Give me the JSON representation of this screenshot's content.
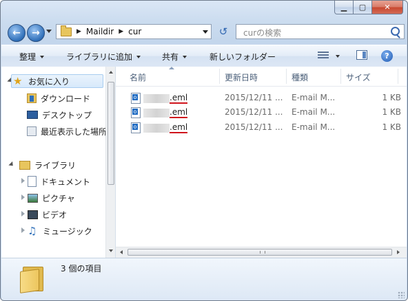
{
  "window": {
    "caption_min": "▁",
    "caption_max": "▢",
    "caption_close": "✕"
  },
  "navigation": {
    "breadcrumb": [
      "Maildir",
      "cur"
    ],
    "search_placeholder": "curの検索"
  },
  "toolbar": {
    "organize": "整理",
    "include_in_library": "ライブラリに追加",
    "share_with": "共有",
    "new_folder": "新しいフォルダー"
  },
  "sidebar": {
    "favorites": "お気に入り",
    "downloads": "ダウンロード",
    "desktop": "デスクトップ",
    "recent_places": "最近表示した場所",
    "libraries": "ライブラリ",
    "documents": "ドキュメント",
    "pictures": "ピクチャ",
    "videos": "ビデオ",
    "music": "ミュージック"
  },
  "columns": {
    "name": "名前",
    "date_modified": "更新日時",
    "type": "種類",
    "size": "サイズ"
  },
  "files": [
    {
      "ext": ".eml",
      "date": "2015/12/11 ...",
      "type": "E-mail M...",
      "size": "1 KB"
    },
    {
      "ext": ".eml",
      "date": "2015/12/11 ...",
      "type": "E-mail M...",
      "size": "1 KB"
    },
    {
      "ext": ".eml",
      "date": "2015/12/11 ...",
      "type": "E-mail M...",
      "size": "1 KB"
    }
  ],
  "status": {
    "item_count": "3 個の項目"
  },
  "colors": {
    "underline": "#d0141c",
    "selection": "#d7e9fb"
  }
}
